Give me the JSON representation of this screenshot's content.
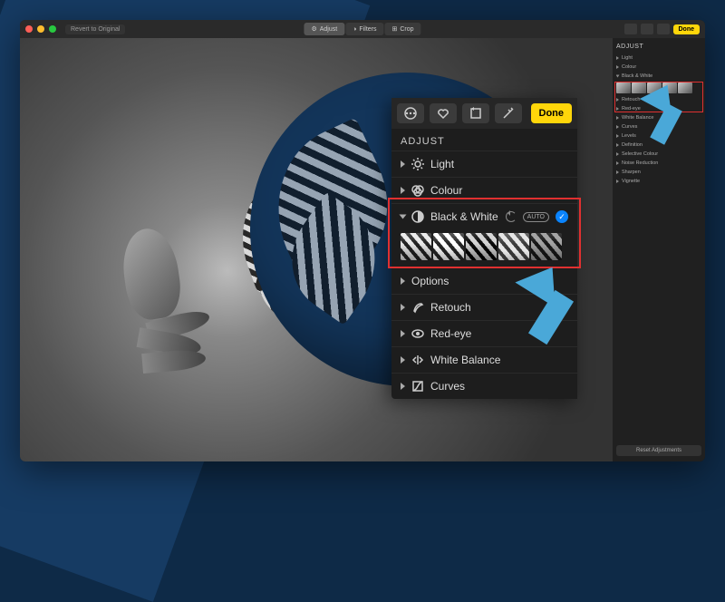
{
  "toolbar": {
    "revert_label": "Revert to Original",
    "tabs": {
      "adjust": "Adjust",
      "filters": "Filters",
      "crop": "Crop"
    },
    "done_label": "Done"
  },
  "sidebar": {
    "title": "ADJUST",
    "items": [
      {
        "label": "Light"
      },
      {
        "label": "Colour"
      },
      {
        "label": "Black & White",
        "auto": "AUTO",
        "expanded": true,
        "checked": true
      },
      {
        "label": "Retouch"
      },
      {
        "label": "Red-eye"
      },
      {
        "label": "White Balance"
      },
      {
        "label": "Curves"
      },
      {
        "label": "Levels"
      },
      {
        "label": "Definition"
      },
      {
        "label": "Selective Colour"
      },
      {
        "label": "Noise Reduction"
      },
      {
        "label": "Sharpen"
      },
      {
        "label": "Vignette"
      }
    ],
    "reset_label": "Reset Adjustments"
  },
  "panel": {
    "title": "ADJUST",
    "done": "Done",
    "rows": {
      "light": "Light",
      "colour": "Colour",
      "bw": "Black & White",
      "bw_auto": "AUTO",
      "options": "Options",
      "retouch": "Retouch",
      "redeye": "Red-eye",
      "wb": "White Balance",
      "curves": "Curves"
    }
  }
}
